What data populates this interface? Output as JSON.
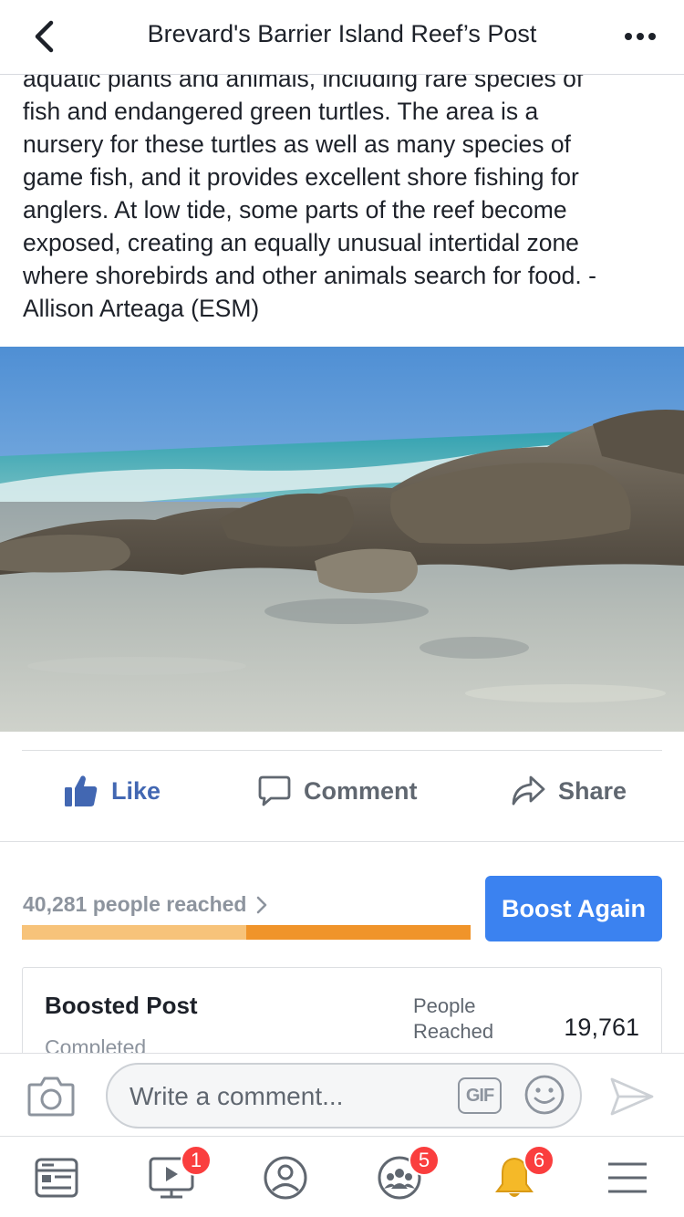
{
  "header": {
    "title": "Brevard's Barrier Island Reef’s Post"
  },
  "post": {
    "text_lines": [
      "aquatic plants and animals, including rare species of",
      "fish and endangered green turtles. The area is a",
      "nursery for these turtles as well as many species of",
      "game fish, and it provides excellent shore fishing for",
      "anglers. At low tide, some parts of the reef become",
      "exposed, creating an equally unusual intertidal zone",
      "where shorebirds and other animals search for food. -",
      "Allison Arteaga (ESM)"
    ]
  },
  "actions": {
    "like": "Like",
    "comment": "Comment",
    "share": "Share"
  },
  "reach": {
    "label": "40,281 people reached",
    "progress_fraction": 0.5,
    "colors": {
      "organic": "#f7c37a",
      "paid": "#f0942a"
    },
    "boost_button": "Boost Again"
  },
  "boost_card": {
    "title": "Boosted Post",
    "status": "Completed",
    "metric_label": "People Reached",
    "metric_value": "19,761"
  },
  "composer": {
    "placeholder": "Write a comment...",
    "gif_label": "GIF"
  },
  "tabbar": {
    "video_badge": "1",
    "groups_badge": "5",
    "notifications_badge": "6"
  },
  "colors": {
    "accent": "#4267b2",
    "boost": "#3b82f0",
    "badge": "#fa3e3e"
  }
}
